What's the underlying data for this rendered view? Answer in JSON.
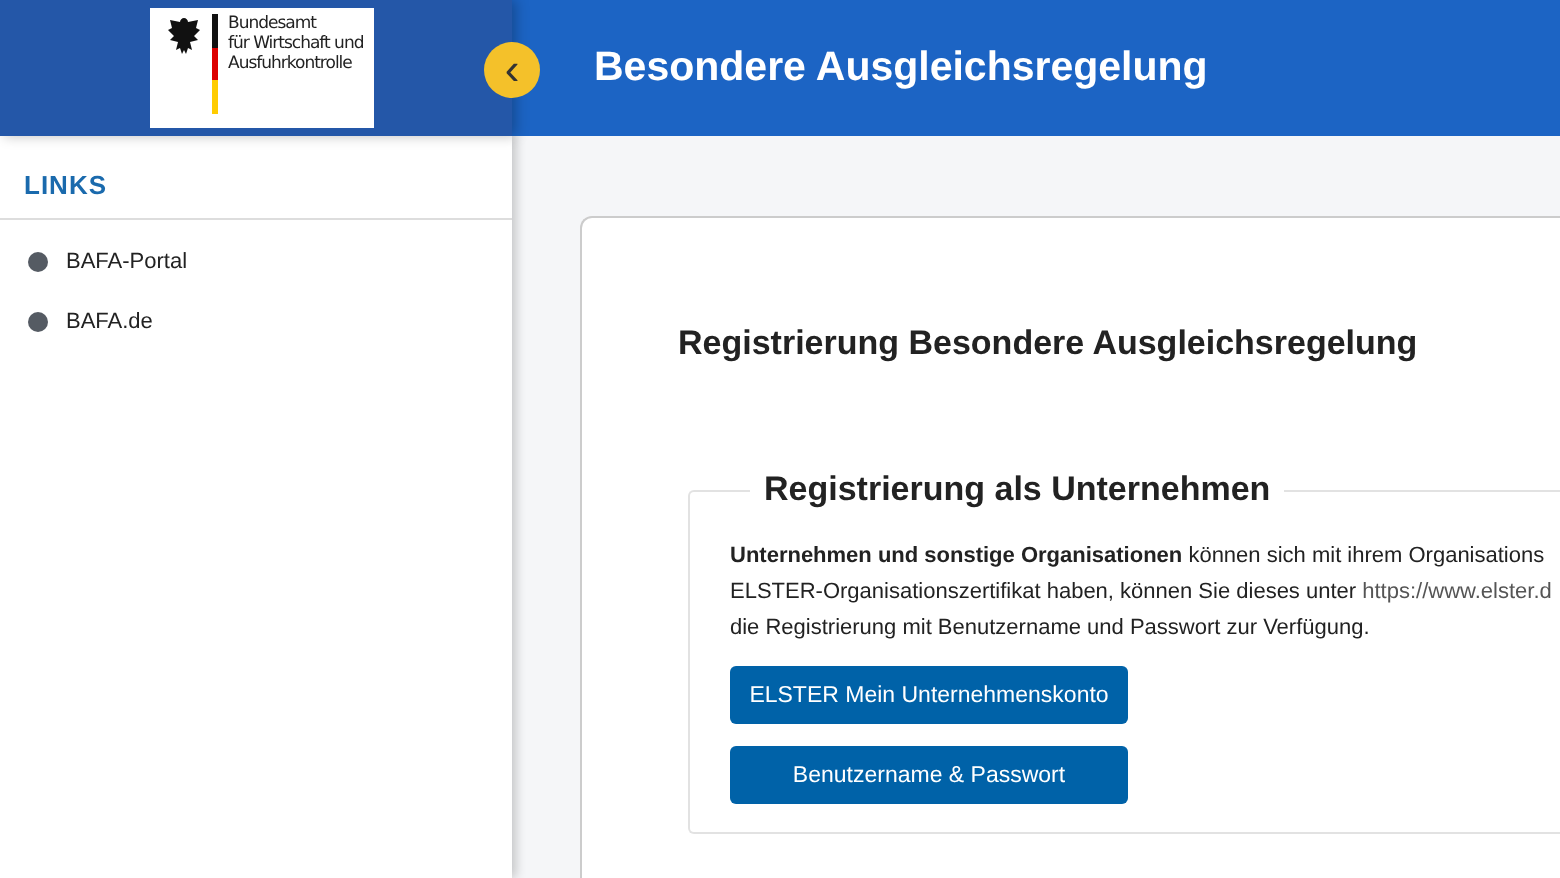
{
  "header": {
    "logo_lines": [
      "Bundesamt",
      "für Wirtschaft und",
      "Ausfuhrkontrolle"
    ],
    "toggle": "‹",
    "title": "Besondere Ausgleichsregelung"
  },
  "sidebar": {
    "heading": "LINKS",
    "items": [
      "BAFA-Portal",
      "BAFA.de"
    ]
  },
  "main": {
    "heading": "Registrierung Besondere Ausgleichsregelung",
    "section": {
      "legend": "Registrierung als Unternehmen",
      "intro": {
        "before": "**Unternehmen und sonstige Organisationen** können sich mit ihrem Organisations\nELSTER-Organisationszertifikat haben, können Sie dieses unter ",
        "link": "https://www.elster.d",
        "after": "\ndie Registrierung mit Benutzername und Passwort zur Verfügung."
      },
      "buttons": [
        "ELSTER Mein Unternehmenskonto",
        "Benutzername & Passwort"
      ]
    }
  }
}
